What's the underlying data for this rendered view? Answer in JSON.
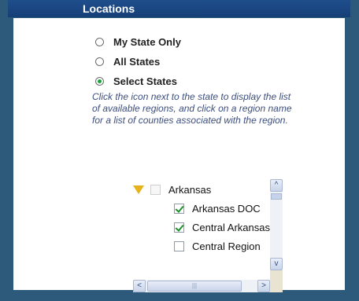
{
  "panel": {
    "title": "Locations"
  },
  "location_options": [
    {
      "label": "My State Only",
      "selected": false
    },
    {
      "label": "All States",
      "selected": false
    },
    {
      "label": "Select States",
      "selected": true
    }
  ],
  "help_text": "Click the icon next to the state to display the list of available regions, and click on a region name for a list of counties associated with the region.",
  "tree": {
    "state": {
      "label": "Arkansas",
      "checked": false,
      "expanded": true
    },
    "regions": [
      {
        "label": "Arkansas DOC",
        "checked": true
      },
      {
        "label": "Central Arkansas",
        "checked": true
      },
      {
        "label": "Central Region",
        "checked": false
      }
    ]
  },
  "scrollbars": {
    "up_glyph": "^",
    "down_glyph": "v",
    "left_glyph": "<",
    "right_glyph": ">",
    "thumb_grip_glyph": "|||"
  },
  "colors": {
    "header_bg": "#1f4e8c",
    "outer_bg": "#2d5a7b",
    "help_text": "#3d4f7e",
    "expand_triangle": "#e8b21a",
    "check_mark": "#1a8f2a",
    "radio_dot": "#1aa33a"
  }
}
